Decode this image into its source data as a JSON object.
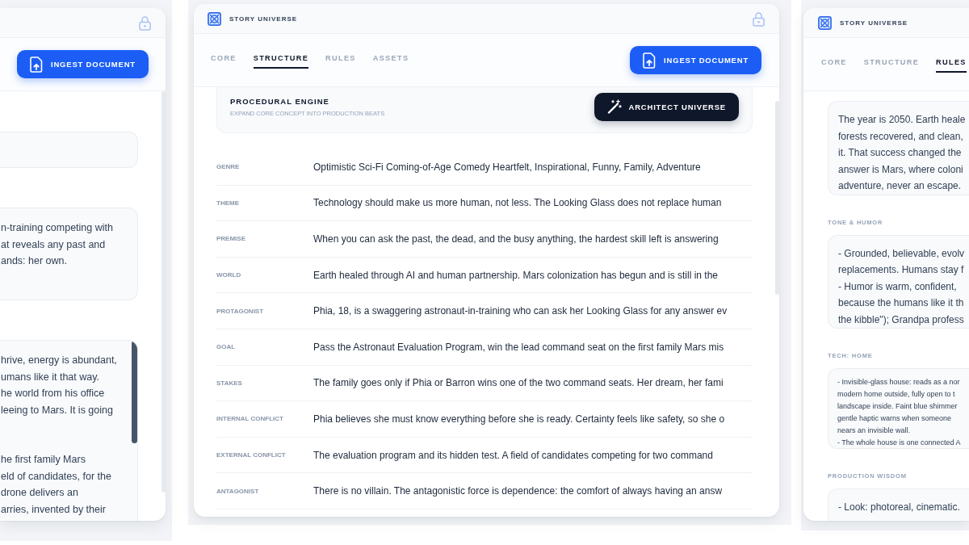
{
  "screens": [
    {
      "locked": true,
      "ingest_button": "INGEST DOCUMENT",
      "content": [
        {
          "kind": "field"
        },
        {
          "kind": "text_box",
          "paragraphs": [
            [
              "n-training competing with",
              "at reveals any past and",
              "ands: her own."
            ]
          ]
        },
        {
          "kind": "text_box",
          "scrollbar": true,
          "paragraphs": [
            [
              "hrive, energy is abundant,",
              "umans like it that way.",
              "he world from his office",
              "leeing to Mars. It is going"
            ],
            [
              "he first family Mars",
              "eld of candidates, for the",
              "drone delivers an",
              "arries, invented by their"
            ]
          ]
        }
      ]
    },
    {
      "app_title": "STORY UNIVERSE",
      "locked": true,
      "tabs": [
        {
          "label": "CORE",
          "selected": false
        },
        {
          "label": "STRUCTURE",
          "selected": true
        },
        {
          "label": "RULES",
          "selected": false
        },
        {
          "label": "ASSETS",
          "selected": false
        }
      ],
      "ingest_button": "INGEST DOCUMENT",
      "content": [
        {
          "kind": "engine",
          "title": "PROCEDURAL ENGINE",
          "subtitle": "EXPAND CORE CONCEPT INTO PRODUCTION BEATS",
          "button": "ARCHITECT UNIVERSE"
        },
        {
          "kind": "table",
          "rows": [
            {
              "label": "GENRE",
              "value": "Optimistic Sci-Fi Coming-of-Age Comedy Heartfelt, Inspirational, Funny, Family, Adventure"
            },
            {
              "label": "THEME",
              "value": "Technology should make us more human, not less. The Looking Glass does not replace human"
            },
            {
              "label": "PREMISE",
              "value": "When you can ask the past, the dead, and the busy anything, the hardest skill left is answering"
            },
            {
              "label": "WORLD",
              "value": "Earth healed through AI and human partnership. Mars colonization has begun and is still in the"
            },
            {
              "label": "PROTAGONIST",
              "value": "Phia, 18, is a swaggering astronaut-in-training who can ask her Looking Glass for any answer ev"
            },
            {
              "label": "GOAL",
              "value": "Pass the Astronaut Evaluation Program, win the lead command seat on the first family Mars mis"
            },
            {
              "label": "STAKES",
              "value": "The family goes only if Phia or Barron wins one of the two command seats. Her dream, her fami"
            },
            {
              "label": "INTERNAL CONFLICT",
              "value": "Phia believes she must know everything before she is ready. Certainty feels like safety, so she o"
            },
            {
              "label": "EXTERNAL CONFLICT",
              "value": "The evaluation program and its hidden test. A field of candidates competing for two command"
            },
            {
              "label": "ANTAGONIST",
              "value": "There is no villain. The antagonistic force is dependence: the comfort of always having an answ"
            }
          ]
        }
      ]
    },
    {
      "app_title": "STORY UNIVERSE",
      "tabs": [
        {
          "label": "CORE",
          "selected": false
        },
        {
          "label": "STRUCTURE",
          "selected": false
        },
        {
          "label": "RULES",
          "selected": true
        }
      ],
      "content": [
        {
          "kind": "text_box",
          "paragraphs": [
            [
              "The year is 2050. Earth heale",
              "forests recovered, and clean,",
              "it. That success changed the",
              "answer is Mars, where coloni",
              "adventure, never an escape."
            ]
          ]
        },
        {
          "kind": "text_box",
          "label": "TONE & HUMOR",
          "paragraphs": [
            [
              "- Grounded, believable, evolv",
              "replacements. Humans stay f",
              "- Humor is warm, confident,",
              "because the humans like it th",
              "the kibble\"); Grandpa profess"
            ]
          ]
        },
        {
          "kind": "note_box",
          "label": "TECH: HOME",
          "paragraphs": [
            [
              "- Invisible-glass house: reads as a nor",
              "modern home outside, fully open to t",
              "landscape inside. Faint blue shimmer",
              "gentle haptic warns when someone",
              "nears an invisible wall.",
              "- The whole house is one connected A"
            ]
          ]
        },
        {
          "kind": "text_box",
          "label": "PRODUCTION WISDOM",
          "paragraphs": [
            [
              "- Look: photoreal, cinematic."
            ]
          ]
        }
      ]
    }
  ]
}
